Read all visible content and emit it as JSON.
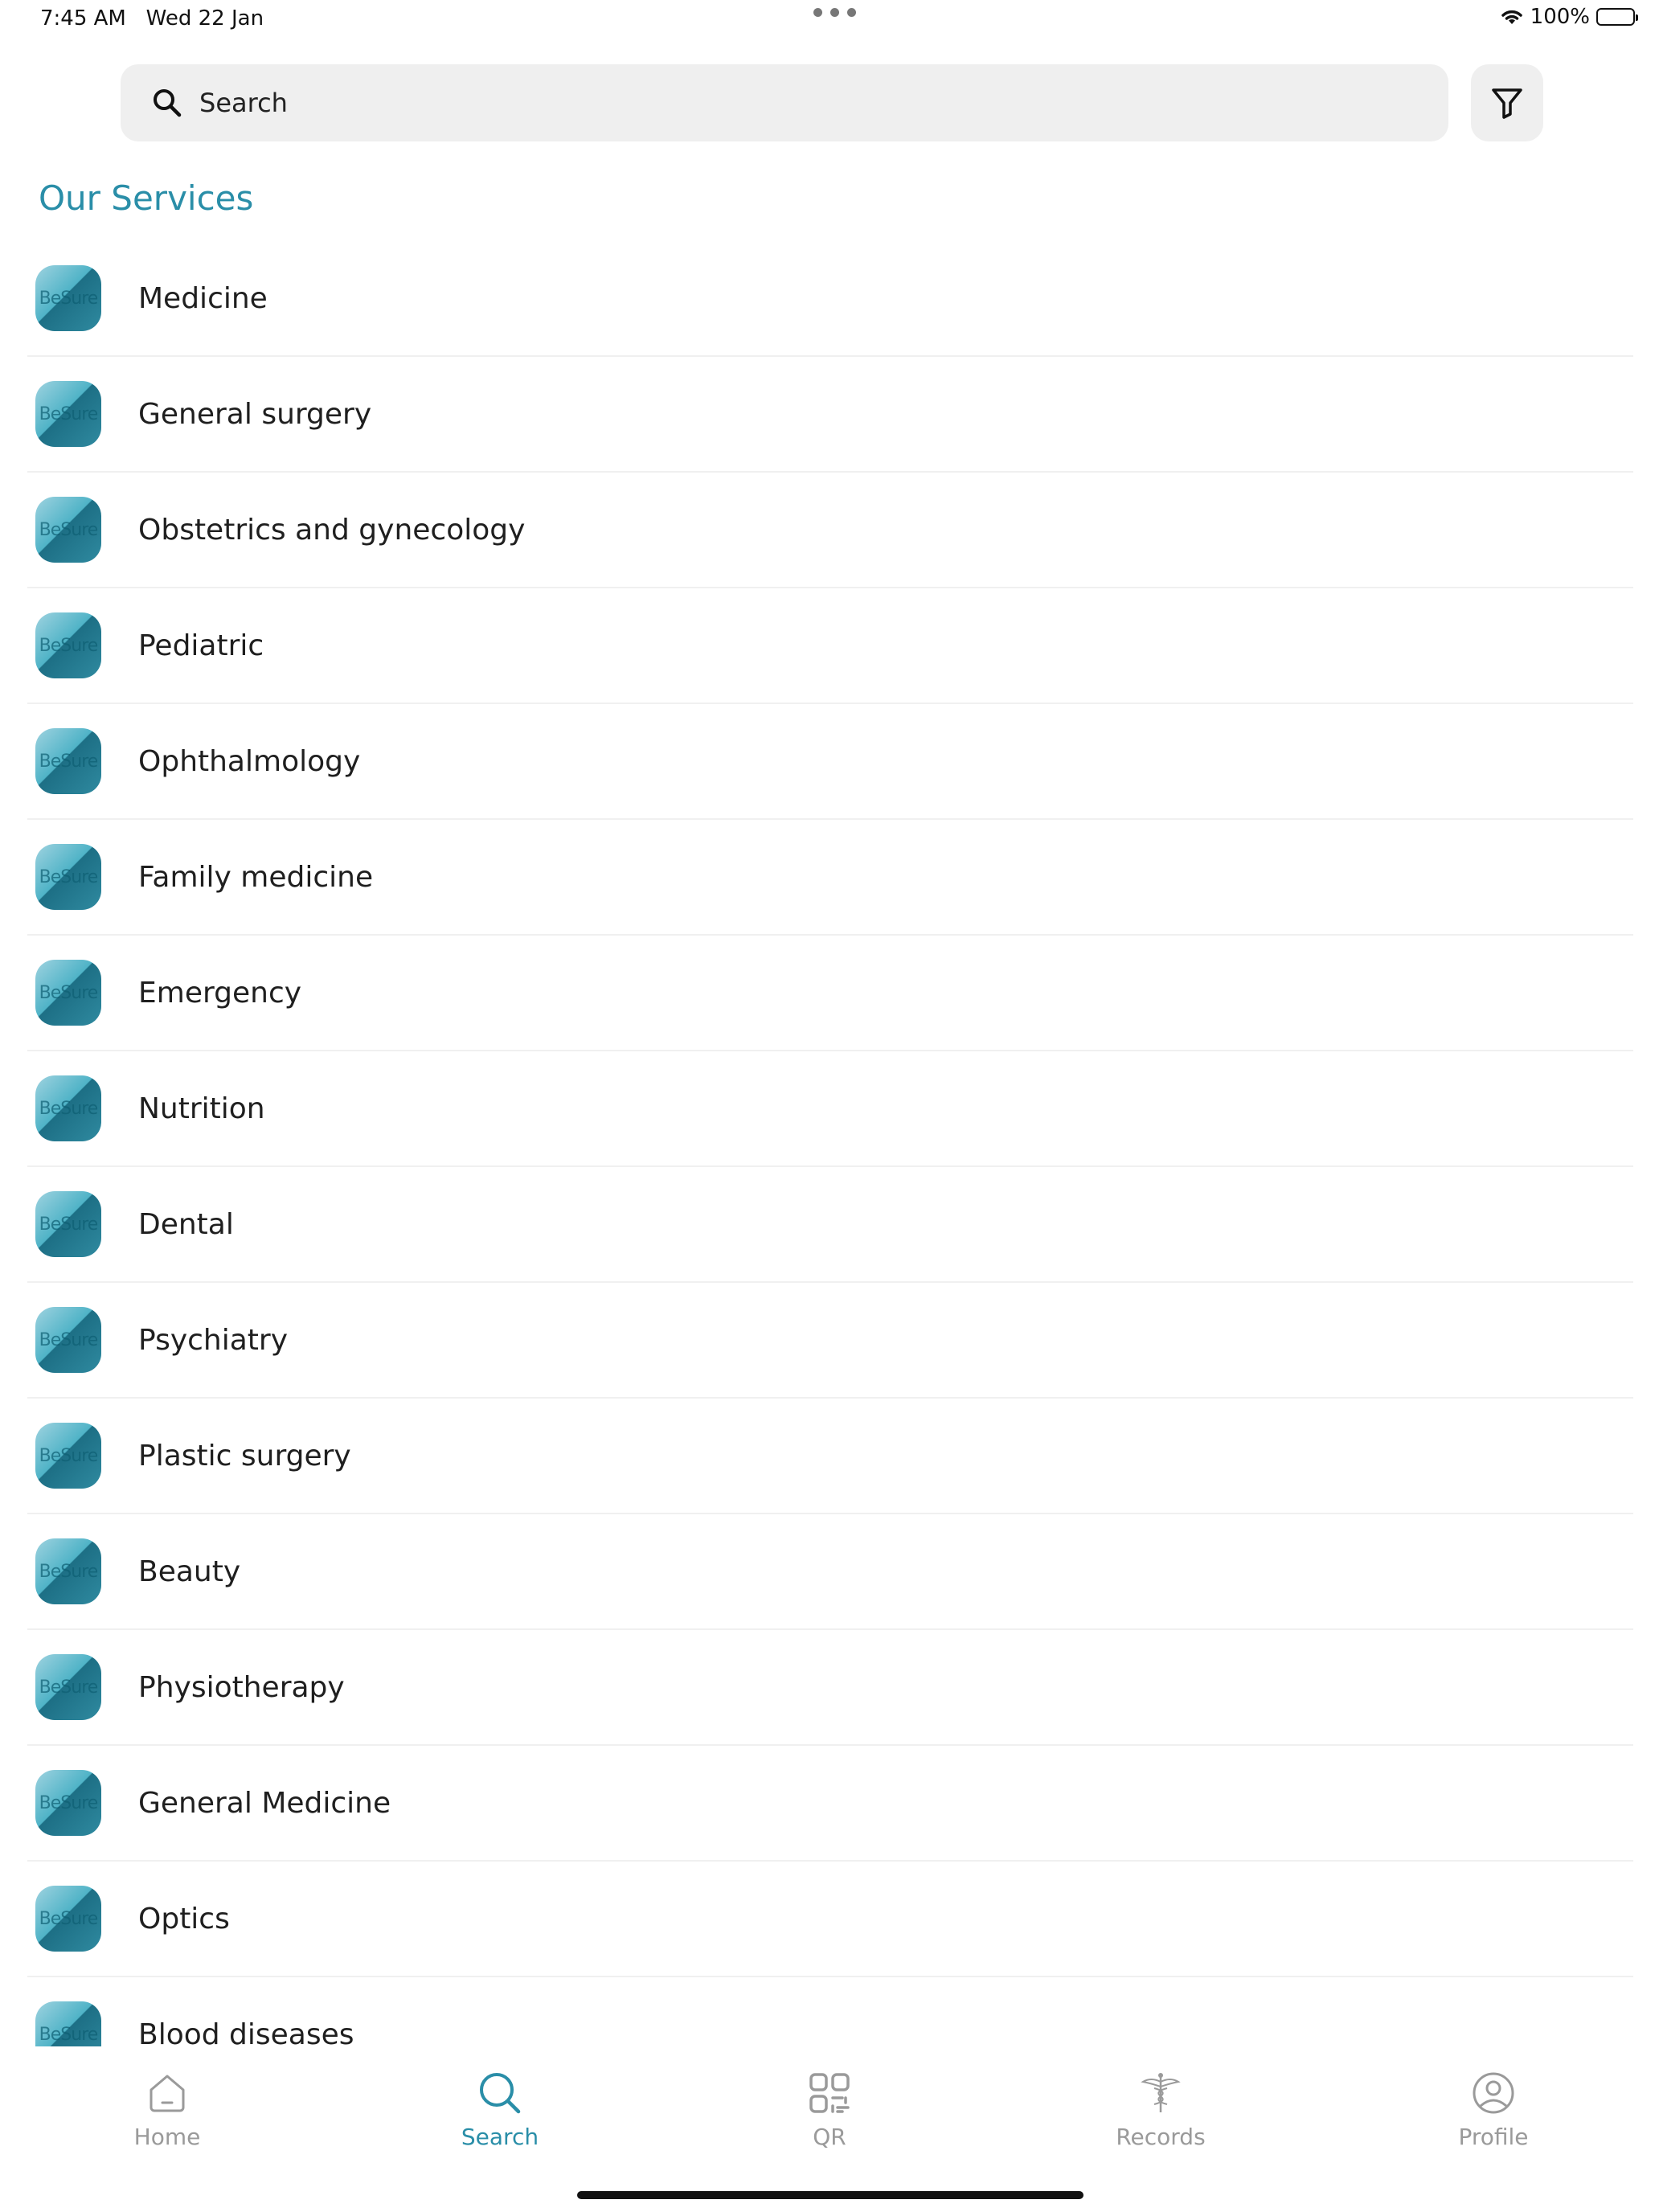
{
  "status_bar": {
    "time": "7:45 AM",
    "date": "Wed 22 Jan",
    "battery": "100%"
  },
  "search": {
    "placeholder": "Search",
    "icon": "search-icon"
  },
  "filter_icon": "filter-icon",
  "section_title": "Our Services",
  "logo_text": "BeSure",
  "services": [
    "Medicine",
    "General surgery",
    "Obstetrics and gynecology",
    "Pediatric",
    "Ophthalmology",
    "Family medicine",
    "Emergency",
    "Nutrition",
    "Dental",
    "Psychiatry",
    "Plastic surgery",
    "Beauty",
    "Physiotherapy",
    "General Medicine",
    "Optics",
    "Blood diseases"
  ],
  "tabs": [
    {
      "label": "Home",
      "icon": "home-icon",
      "active": false
    },
    {
      "label": "Search",
      "icon": "search-icon",
      "active": true
    },
    {
      "label": "QR",
      "icon": "qr-icon",
      "active": false
    },
    {
      "label": "Records",
      "icon": "caduceus-icon",
      "active": false
    },
    {
      "label": "Profile",
      "icon": "profile-icon",
      "active": false
    }
  ],
  "colors": {
    "accent": "#2a8ea8",
    "inactive_tab": "#9a9a9a",
    "search_background": "#efefef"
  }
}
